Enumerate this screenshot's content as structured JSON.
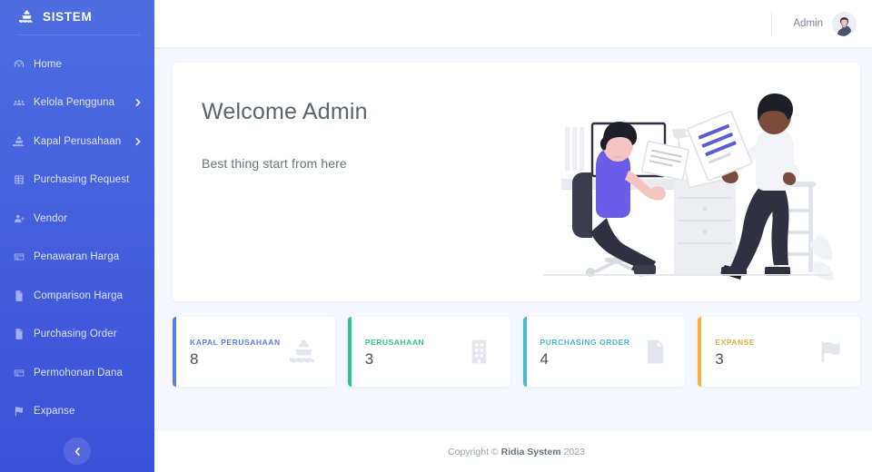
{
  "sidebar": {
    "brand": {
      "label": "SISTEM",
      "icon": "ship-icon"
    },
    "items": [
      {
        "label": "Home",
        "icon": "dashboard-icon",
        "expandable": false
      },
      {
        "label": "Kelola Pengguna",
        "icon": "users-icon",
        "expandable": true
      },
      {
        "label": "Kapal Perusahaan",
        "icon": "ship-icon",
        "expandable": true
      },
      {
        "label": "Purchasing Request",
        "icon": "table-icon",
        "expandable": false
      },
      {
        "label": "Vendor",
        "icon": "user-add-icon",
        "expandable": false
      },
      {
        "label": "Penawaran Harga",
        "icon": "card-icon",
        "expandable": false
      },
      {
        "label": "Comparison Harga",
        "icon": "file-icon",
        "expandable": false
      },
      {
        "label": "Purchasing Order",
        "icon": "file-chart-icon",
        "expandable": false
      },
      {
        "label": "Permohonan Dana",
        "icon": "card-icon",
        "expandable": false
      },
      {
        "label": "Expanse",
        "icon": "flag-icon",
        "expandable": false
      }
    ],
    "collapse_icon": "chevron-left-icon",
    "background_start": "#4e6ee0",
    "background_end": "#3a52d8"
  },
  "topbar": {
    "user_name": "Admin",
    "avatar_icon": "user-avatar"
  },
  "welcome": {
    "title": "Welcome Admin",
    "subtitle": "Best thing start from here",
    "illustration": "office-teamwork-illustration"
  },
  "stats": [
    {
      "label": "KAPAL PERUSAHAAN",
      "value": "8",
      "color": "#5a7de0",
      "icon": "ship-icon"
    },
    {
      "label": "PERUSAHAAN",
      "value": "3",
      "color": "#2fc48d",
      "icon": "building-icon"
    },
    {
      "label": "PURCHASING ORDER",
      "value": "4",
      "color": "#4bb8c9",
      "icon": "document-chart-icon"
    },
    {
      "label": "EXPANSE",
      "value": "3",
      "color": "#f2b33d",
      "icon": "flag-icon"
    }
  ],
  "footer": {
    "prefix": "Copyright ©",
    "brand": "Ridia System",
    "year": "2023"
  }
}
